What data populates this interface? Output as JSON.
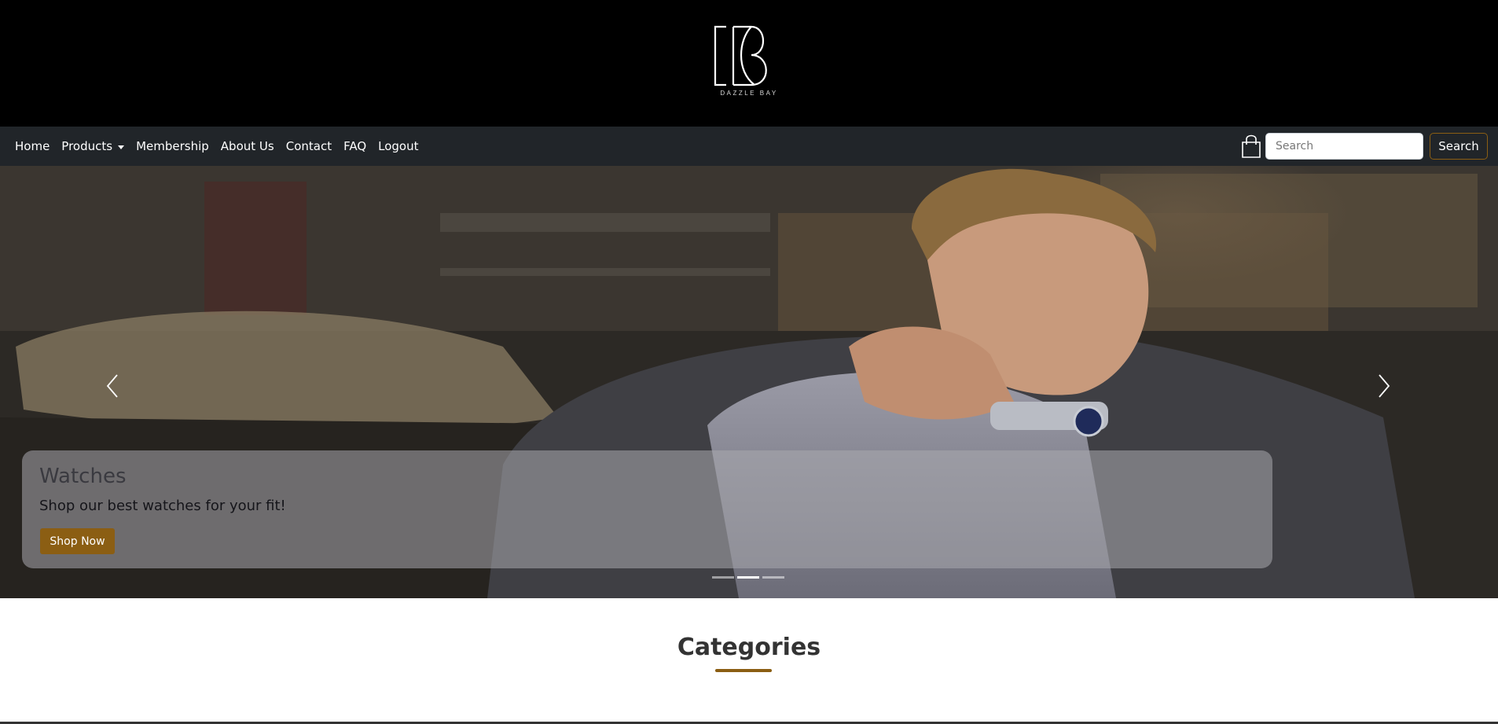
{
  "brand": {
    "logo_text": "DAZZLE BAY",
    "accent_color": "#8b5e13"
  },
  "nav": {
    "links": [
      {
        "label": "Home"
      },
      {
        "label": "Products",
        "dropdown": true
      },
      {
        "label": "Membership"
      },
      {
        "label": "About Us"
      },
      {
        "label": "Contact"
      },
      {
        "label": "FAQ"
      },
      {
        "label": "Logout"
      }
    ],
    "cart_icon": "shopping-bag-icon",
    "search": {
      "placeholder": "Search",
      "value": "",
      "button_label": "Search"
    }
  },
  "carousel": {
    "caption": {
      "title": "Watches",
      "text": "Shop our best watches for your fit!",
      "button_label": "Shop Now"
    },
    "slide_count": 3,
    "active_index": 1,
    "prev_icon": "chevron-left-icon",
    "next_icon": "chevron-right-icon"
  },
  "categories": {
    "title": "Categories"
  }
}
